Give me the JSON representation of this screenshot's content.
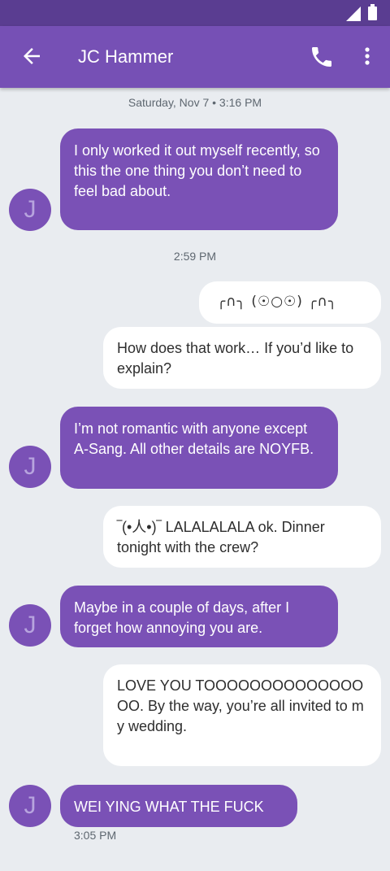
{
  "status_bar": {
    "signal_icon": "signal-icon",
    "battery_icon": "battery-icon"
  },
  "app_bar": {
    "title": "JC Hammer",
    "back_icon": "arrow-back-icon",
    "call_icon": "phone-icon",
    "more_icon": "more-vert-icon",
    "color": "#7650b5"
  },
  "conversation": {
    "header_timestamp": "Saturday, Nov 7 • 3:16 PM",
    "mid_timestamp": "2:59 PM",
    "footer_timestamp": "3:05 PM",
    "contact_initial": "J",
    "messages": [
      {
        "direction": "incoming",
        "text": "I only worked it out myself recently, so this the one thing you don’t need to feel bad about."
      },
      {
        "direction": "outgoing",
        "text": "╭∩╮ (☉○☉) ╭∩╮"
      },
      {
        "direction": "outgoing",
        "text": "How does that work… If you’d like to explain?"
      },
      {
        "direction": "incoming",
        "text": "I’m not romantic with anyone except A-Sang. All other details are NOYFB."
      },
      {
        "direction": "outgoing",
        "text": "‾(•人•)‾ LALALALALA ok. Dinner tonight with the crew?"
      },
      {
        "direction": "incoming",
        "text": "Maybe in a couple of days, after I forget how annoying you are."
      },
      {
        "direction": "outgoing",
        "text": "LOVE YOU TOOOOOOOOOOOOOOOO. By the way, you’re all invited to my wedding."
      },
      {
        "direction": "incoming",
        "text": "WEI YING WHAT THE FUCK"
      }
    ]
  },
  "colors": {
    "incoming_bubble": "#7a51b6",
    "outgoing_bubble": "#ffffff",
    "background": "#e9ecf0"
  }
}
